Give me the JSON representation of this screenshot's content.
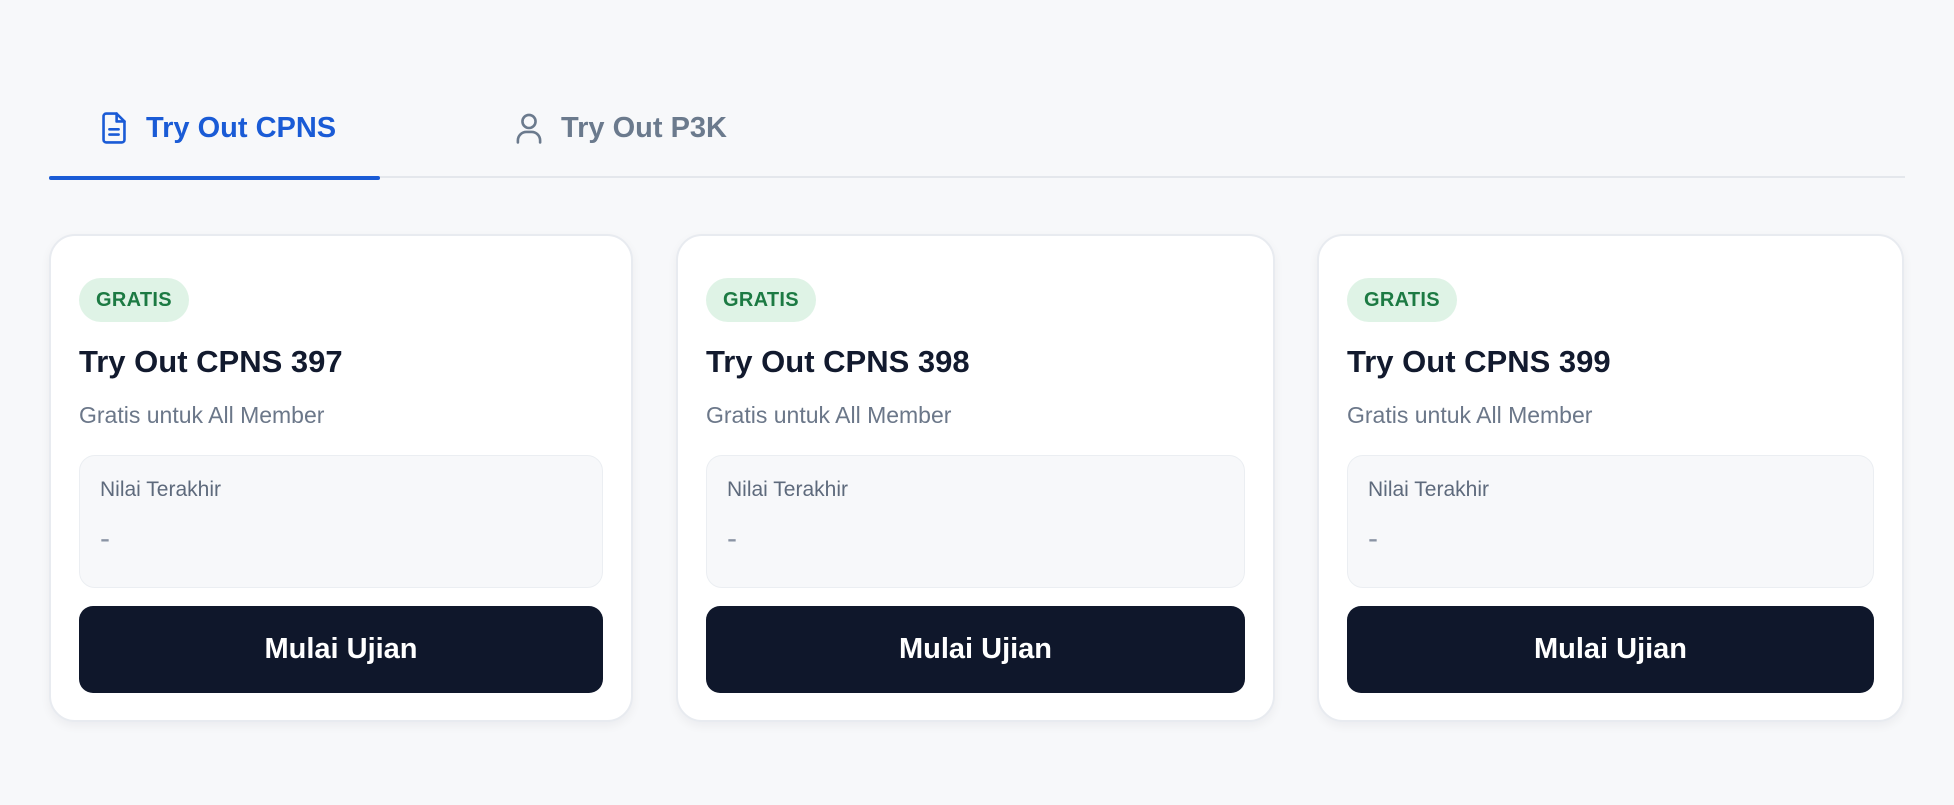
{
  "tabs": [
    {
      "label": "Try Out CPNS",
      "icon": "document-icon",
      "active": true,
      "color": "#1a5bd6"
    },
    {
      "label": "Try Out P3K",
      "icon": "user-icon",
      "active": false,
      "color": "#6b7a8d"
    }
  ],
  "cards": [
    {
      "badge": "GRATIS",
      "title": "Try Out CPNS 397",
      "subtitle": "Gratis untuk All Member",
      "score_label": "Nilai Terakhir",
      "score_value": "-",
      "button_label": "Mulai Ujian"
    },
    {
      "badge": "GRATIS",
      "title": "Try Out CPNS 398",
      "subtitle": "Gratis untuk All Member",
      "score_label": "Nilai Terakhir",
      "score_value": "-",
      "button_label": "Mulai Ujian"
    },
    {
      "badge": "GRATIS",
      "title": "Try Out CPNS 399",
      "subtitle": "Gratis untuk All Member",
      "score_label": "Nilai Terakhir",
      "score_value": "-",
      "button_label": "Mulai Ujian"
    }
  ],
  "colors": {
    "accent": "#1a5bd6",
    "badge_bg": "#dff3e6",
    "badge_text": "#1c7a43",
    "button_bg": "#0f172b",
    "page_bg": "#f7f8fa"
  }
}
